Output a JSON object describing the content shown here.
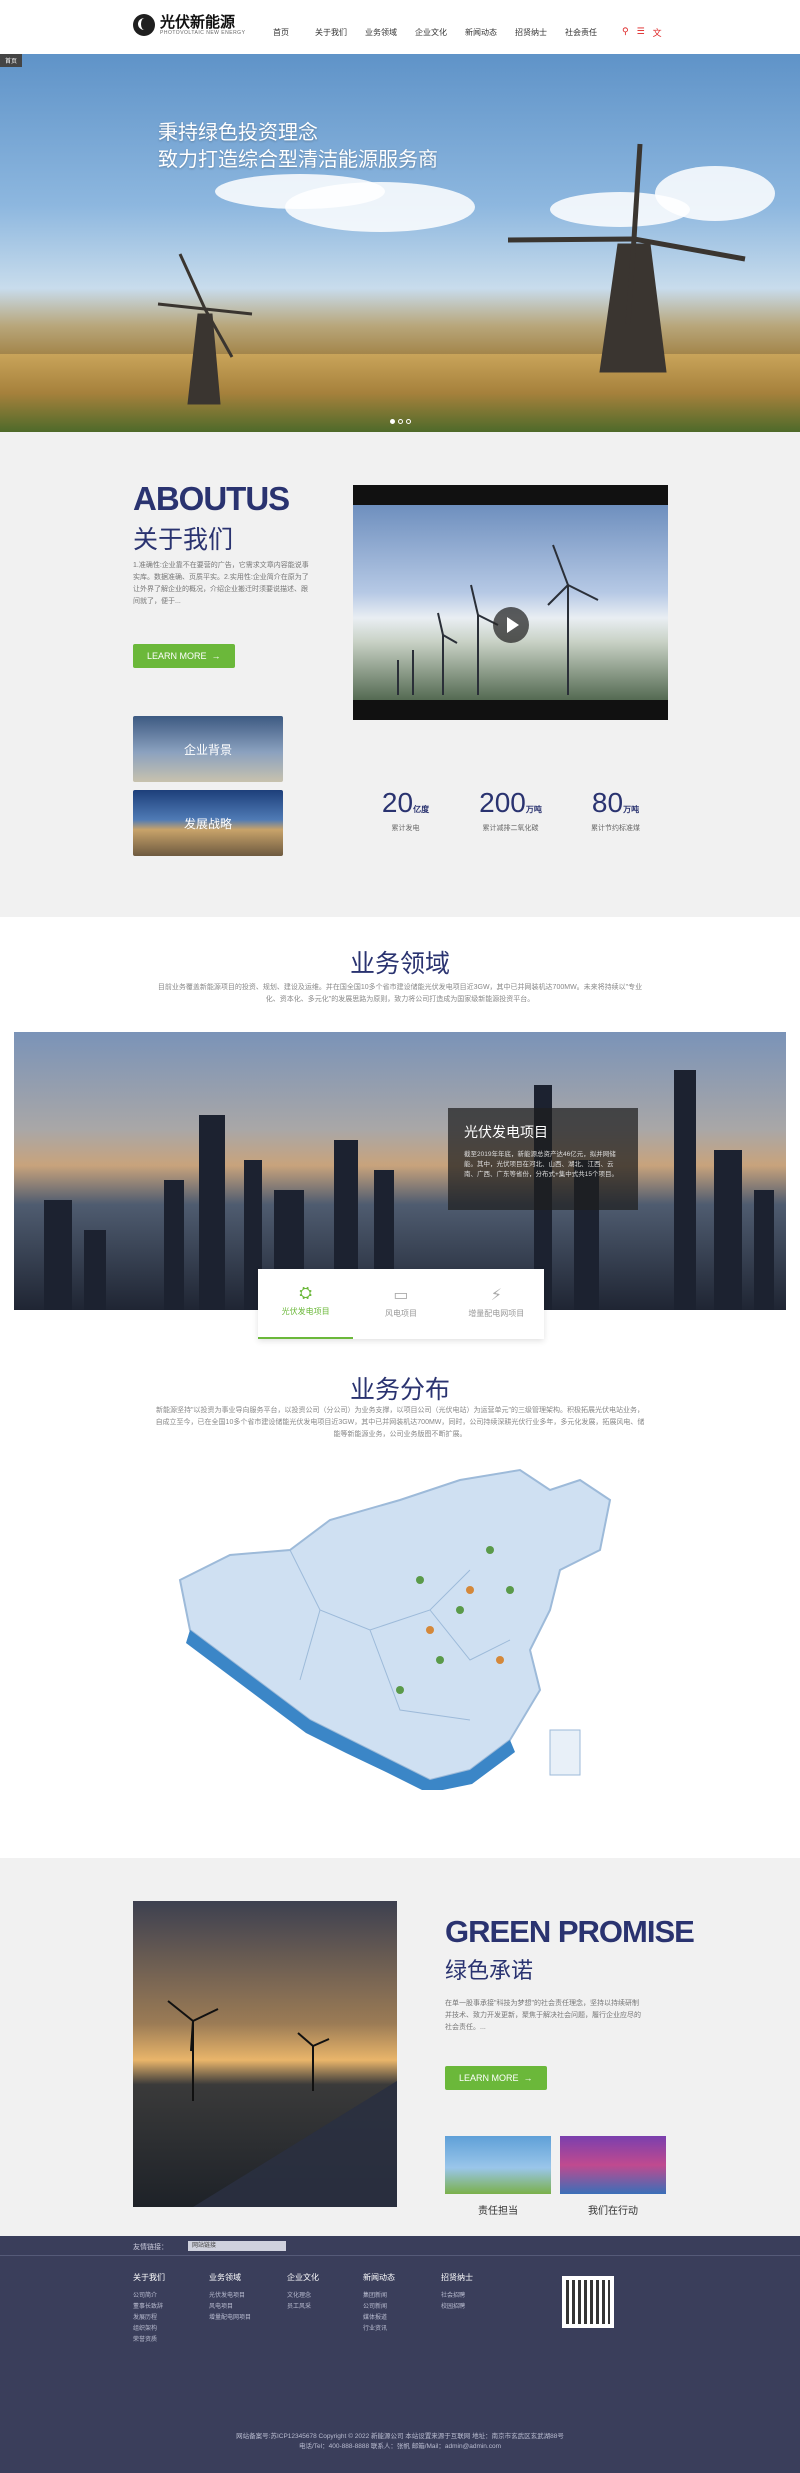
{
  "header": {
    "logo_cn": "光伏新能源",
    "logo_en": "PHOTOVOLTAIC NEW ENERGY",
    "nav": [
      "首页",
      "关于我们",
      "业务领域",
      "企业文化",
      "新闻动态",
      "招贤纳士",
      "社会责任"
    ]
  },
  "banner": {
    "tag": "首页",
    "line1": "秉持绿色投资理念",
    "line2": "致力打造综合型清洁能源服务商"
  },
  "about": {
    "en": "ABOUTUS",
    "cn": "关于我们",
    "text": "1.准确性:企业靠不在要营的广告，它需求文章内容能说事实库。数据准确、页质平实。2.实用性:企业简介在原为了让外界了解企业的概况，介绍企业搬迁时须要说描述、跟间就了，便于...",
    "btn": "LEARN MORE",
    "thumb1": "企业背景",
    "thumb2": "发展战略",
    "stats": [
      {
        "num": "20",
        "unit": "亿度",
        "label": "累计发电"
      },
      {
        "num": "200",
        "unit": "万吨",
        "label": "累计减排二氧化碳"
      },
      {
        "num": "80",
        "unit": "万吨",
        "label": "累计节约标准煤"
      }
    ]
  },
  "business": {
    "title": "业务领域",
    "text": "目前业务覆盖新能源项目的投资、规划、建设及运维。并在国全国10多个省市建设储能光伏发电项目近3GW，其中已并网装机达700MW。未来将持续以\"专业化、资本化、多元化\"的发展思路为原则，致力将公司打造成为国家级新能源投资平台。",
    "card_title": "光伏发电项目",
    "card_text": "截至2019年年底，新能源总资产达46亿元，拟并网储能。其中，光伏项目在河北、山西、湖北、江西、云南、广西、广东等省份，分布式+集中式共15个项目。",
    "tabs": [
      "光伏发电项目",
      "风电项目",
      "增量配电网项目"
    ]
  },
  "distribution": {
    "title": "业务分布",
    "text": "新能源坚持\"以投资为事业导向服务平台，以投资公司（分公司）为业务支撑，以项目公司（光伏电站）为运营单元\"的三级管理架构。积极拓展光伏电站业务，自成立至今，已在全国10多个省市建设储能光伏发电项目近3GW，其中已并网装机达700MW，同时，公司持续深耕光伏行业多年，多元化发展，拓展风电、储能等新能源业务，公司业务版图不断扩展。"
  },
  "green": {
    "en": "GREEN PROMISE",
    "cn": "绿色承诺",
    "text": "在单一股事承接\"科技为梦想\"的社会责任理念，坚持以持续研制并技术、致力开发更新，聚焦于解决社会问题，履行企业应尽的社会责任。...",
    "btn": "LEARN MORE",
    "thumb1": "责任担当",
    "thumb2": "我们在行动"
  },
  "footer": {
    "links_label": "友情链接：",
    "select": "网站链接",
    "cols": [
      {
        "h": "关于我们",
        "items": [
          "公司简介",
          "董事长致辞",
          "发展历程",
          "组织架构",
          "荣誉资质"
        ]
      },
      {
        "h": "业务领域",
        "items": [
          "光伏发电项目",
          "风电项目",
          "增量配电网项目"
        ]
      },
      {
        "h": "企业文化",
        "items": [
          "文化理念",
          "员工风采"
        ]
      },
      {
        "h": "新闻动态",
        "items": [
          "集团新闻",
          "公司新闻",
          "媒体报道",
          "行业资讯"
        ]
      },
      {
        "h": "招贤纳士",
        "items": [
          "社会招聘",
          "校园招聘"
        ]
      }
    ],
    "copy1": "网站备案号:苏ICP12345678 Copyright © 2022 新能源公司 本站设置来源于互联网    地址：南京市玄武区玄武湖88号",
    "copy2": "电话/Tel：400-888-8888 联系人：张帆 邮箱/Mail：admin@admin.com"
  }
}
